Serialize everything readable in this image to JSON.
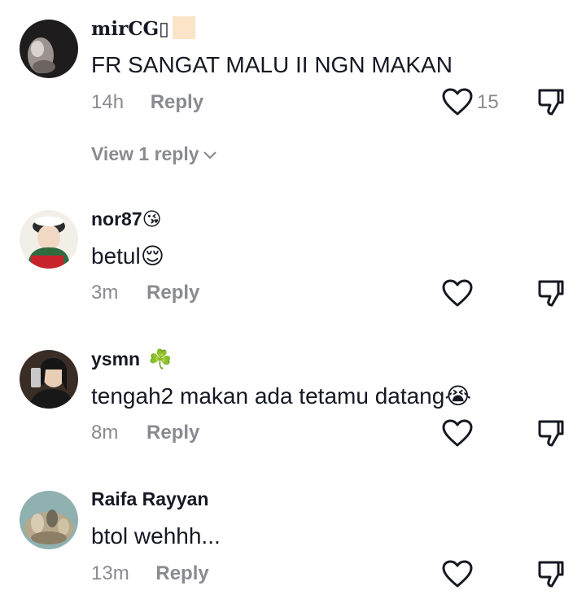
{
  "comments": [
    {
      "username": "mirCG",
      "username_suffix": "▯",
      "text": "FR SANGAT MALU II NGN MAKAN",
      "time": "14h",
      "reply_label": "Reply",
      "likes": "15",
      "view_replies": "View 1 reply"
    },
    {
      "username": "nor87",
      "username_emoji": "😘",
      "text": "betul",
      "text_emoji": "😌",
      "time": "3m",
      "reply_label": "Reply"
    },
    {
      "username": "ysmn",
      "username_emoji": "☘️",
      "text": "tengah2 makan ada tetamu datang",
      "text_emoji": "😭",
      "time": "8m",
      "reply_label": "Reply"
    },
    {
      "username": "Raifa Rayyan",
      "text": "btol wehhh...",
      "time": "13m",
      "reply_label": "Reply"
    }
  ],
  "colors": {
    "text": "#161823",
    "muted": "#8a8b91",
    "skin_swatch": "#fbe4c8"
  },
  "icons": {
    "like": "heart-outline-icon",
    "dislike": "thumbs-down-outline-icon",
    "expand": "chevron-down-icon"
  }
}
